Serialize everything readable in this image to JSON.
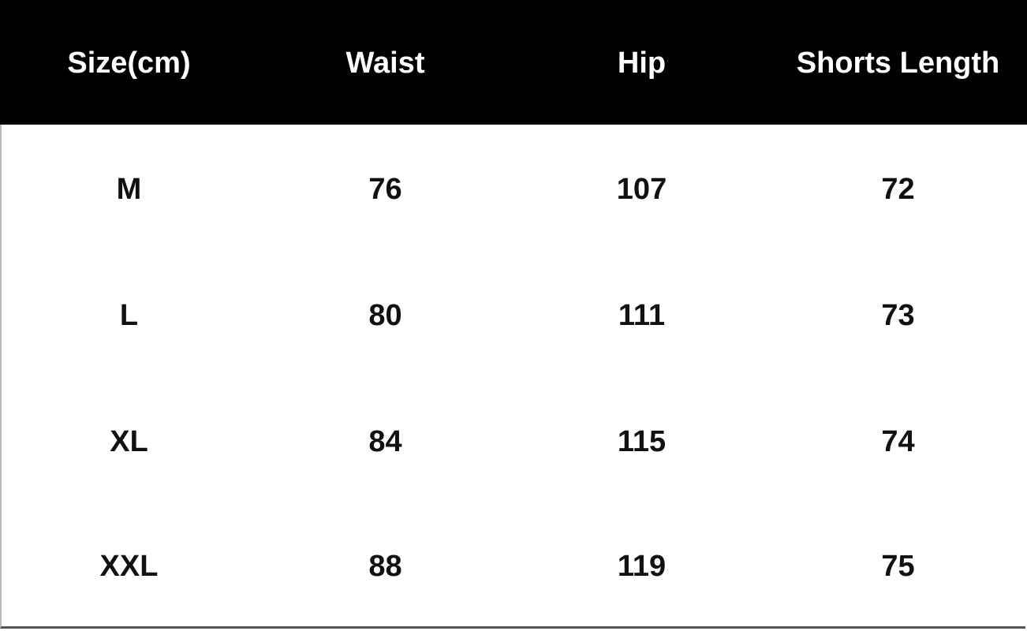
{
  "table": {
    "headers": [
      "Size(cm)",
      "Waist",
      "Hip",
      "Shorts Length"
    ],
    "rows": [
      [
        "M",
        "76",
        "107",
        "72"
      ],
      [
        "L",
        "80",
        "111",
        "73"
      ],
      [
        "XL",
        "84",
        "115",
        "74"
      ],
      [
        "XXL",
        "88",
        "119",
        "75"
      ]
    ]
  },
  "colors": {
    "header_bg": "#000000",
    "header_text": "#ffffff",
    "body_text": "#111111"
  }
}
